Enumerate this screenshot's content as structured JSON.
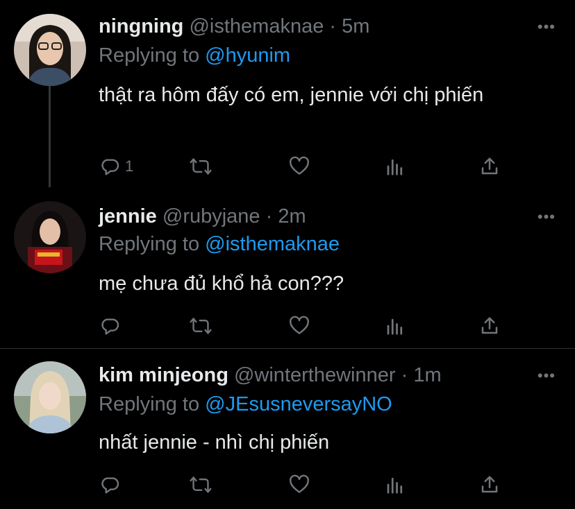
{
  "tweets": [
    {
      "name": "ningning",
      "handle": "@isthemaknae",
      "separator": "·",
      "time": "5m",
      "reply_prefix": "Replying to",
      "reply_to": "@hyunim",
      "text": "thật ra hôm đấy có em, jennie với chị phiến",
      "reply_count": "1",
      "more": "•••"
    },
    {
      "name": "jennie",
      "handle": "@rubyjane",
      "separator": "·",
      "time": "2m",
      "reply_prefix": "Replying to",
      "reply_to": "@isthemaknae",
      "text": "mẹ chưa đủ khổ hả con???",
      "reply_count": "",
      "more": "•••"
    },
    {
      "name": "kim minjeong",
      "handle": "@winterthewinner",
      "separator": "·",
      "time": "1m",
      "reply_prefix": "Replying to",
      "reply_to": "@JEsusneversayNO",
      "text": "nhất jennie - nhì chị phiến",
      "reply_count": "",
      "more": "•••"
    }
  ],
  "icons": {
    "reply": "reply-icon",
    "retweet": "retweet-icon",
    "like": "like-icon",
    "analytics": "analytics-icon",
    "share": "share-icon",
    "more": "more-icon"
  },
  "colors": {
    "background": "#000000",
    "text": "#e7e9ea",
    "secondary": "#71767b",
    "link": "#1d9bf0",
    "divider": "#2f3336"
  }
}
